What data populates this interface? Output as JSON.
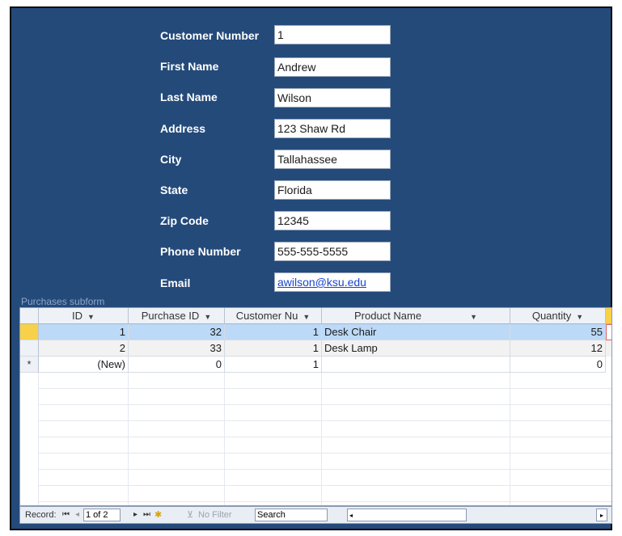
{
  "form": {
    "fields": [
      {
        "label": "Customer Number",
        "value": "1"
      },
      {
        "label": "First Name",
        "value": "Andrew"
      },
      {
        "label": "Last Name",
        "value": "Wilson"
      },
      {
        "label": "Address",
        "value": "123 Shaw Rd"
      },
      {
        "label": "City",
        "value": "Tallahassee"
      },
      {
        "label": "State",
        "value": "Florida"
      },
      {
        "label": "Zip Code",
        "value": "12345"
      },
      {
        "label": "Phone Number",
        "value": "555-555-5555"
      },
      {
        "label": "Email",
        "value": "awilson@ksu.edu"
      }
    ]
  },
  "subform": {
    "caption": "Purchases subform",
    "columns": [
      "ID",
      "Purchase ID",
      "Customer Nu",
      "Product Name",
      "Quantity"
    ],
    "rows": [
      {
        "id": "1",
        "purchase_id": "32",
        "customer_nu": "1",
        "product": "Desk Chair",
        "quantity": "55"
      },
      {
        "id": "2",
        "purchase_id": "33",
        "customer_nu": "1",
        "product": "Desk Lamp",
        "quantity": "12"
      },
      {
        "id": "(New)",
        "purchase_id": "0",
        "customer_nu": "1",
        "product": "",
        "quantity": "0"
      }
    ],
    "new_row_marker": "*",
    "navigation": {
      "record_label": "Record:",
      "position": "1 of 2",
      "filter_label": "No Filter",
      "search_placeholder": "Search"
    }
  },
  "colors": {
    "form_background": "#244a7a",
    "selected_row": "#bcd9f7",
    "selector_active": "#f7d14a"
  },
  "icons": {
    "first": "first-record-icon",
    "prev": "prev-record-icon",
    "next": "next-record-icon",
    "last": "last-record-icon",
    "new": "new-record-icon",
    "filter": "no-filter-icon",
    "sort": "column-dropdown-icon"
  }
}
